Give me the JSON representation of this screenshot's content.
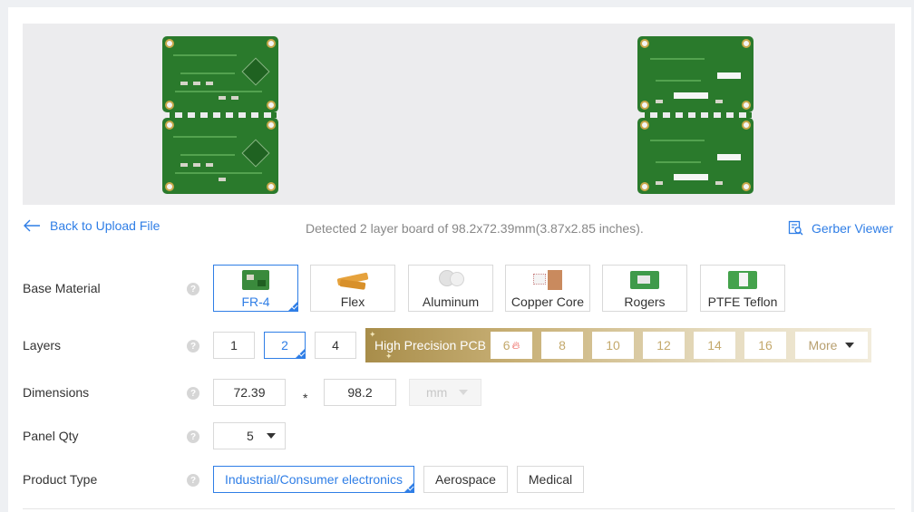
{
  "nav": {
    "back_label": "Back to Upload File",
    "detected_text": "Detected 2 layer board of 98.2x72.39mm(3.87x2.85 inches).",
    "gerber_label": "Gerber Viewer"
  },
  "base_material": {
    "label": "Base Material",
    "help": "?",
    "options": [
      "FR-4",
      "Flex",
      "Aluminum",
      "Copper Core",
      "Rogers",
      "PTFE Teflon"
    ],
    "selected": "FR-4"
  },
  "layers": {
    "label": "Layers",
    "help": "?",
    "options": [
      "1",
      "2",
      "4"
    ],
    "selected": "2",
    "high_precision_title": "High Precision PCB",
    "high_precision_options": [
      "6",
      "8",
      "10",
      "12",
      "14",
      "16"
    ],
    "more_label": "More",
    "hot_icon": "fire-icon"
  },
  "dimensions": {
    "label": "Dimensions",
    "help": "?",
    "width": "72.39",
    "separator": "*",
    "length": "98.2",
    "unit": "mm"
  },
  "panel_qty": {
    "label": "Panel Qty",
    "help": "?",
    "value": "5"
  },
  "product_type": {
    "label": "Product Type",
    "help": "?",
    "options": [
      "Industrial/Consumer electronics",
      "Aerospace",
      "Medical"
    ],
    "selected": "Industrial/Consumer electronics"
  },
  "colors": {
    "accent": "#2f7ee6",
    "pcb_green": "#2a7a2c",
    "gold": "#c4a96c"
  }
}
